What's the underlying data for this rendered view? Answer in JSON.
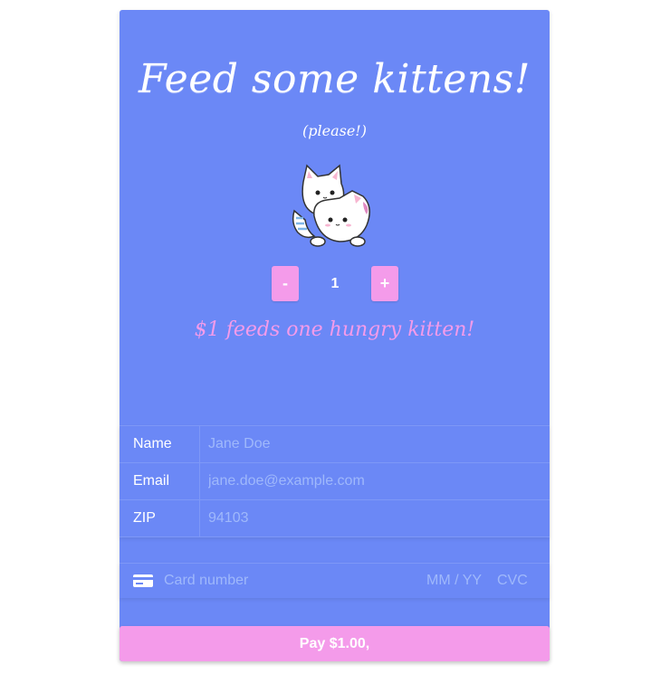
{
  "header": {
    "title": "Feed some kittens!",
    "subtitle": "(please!)"
  },
  "illustration": {
    "icon": "kittens-illustration"
  },
  "stepper": {
    "minus_label": "-",
    "quantity": "1",
    "plus_label": "+"
  },
  "tagline": "$1 feeds one hungry kitten!",
  "billing": {
    "name_label": "Name",
    "name_placeholder": "Jane Doe",
    "email_label": "Email",
    "email_placeholder": "jane.doe@example.com",
    "zip_label": "ZIP",
    "zip_placeholder": "94103"
  },
  "card": {
    "icon": "credit-card-icon",
    "number_placeholder": "Card number",
    "expiry_placeholder": "MM / YY",
    "cvc_placeholder": "CVC"
  },
  "pay_button": {
    "label": "Pay $1.00,"
  },
  "colors": {
    "background": "#6b88f6",
    "accent": "#f49bea",
    "placeholder": "#9fb8fb"
  }
}
